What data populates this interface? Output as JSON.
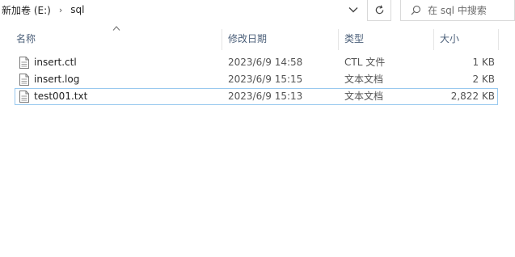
{
  "breadcrumb": {
    "items": [
      "新加卷 (E:)",
      "sql"
    ],
    "separator": "›"
  },
  "search": {
    "placeholder": "在 sql 中搜索"
  },
  "columns": {
    "name": "名称",
    "modified": "修改日期",
    "type": "类型",
    "size": "大小"
  },
  "files": [
    {
      "name": "insert.ctl",
      "modified": "2023/6/9 14:58",
      "type": "CTL 文件",
      "size": "1 KB"
    },
    {
      "name": "insert.log",
      "modified": "2023/6/9 15:15",
      "type": "文本文档",
      "size": "2 KB"
    },
    {
      "name": "test001.txt",
      "modified": "2023/6/9 15:13",
      "type": "文本文档",
      "size": "2,822 KB"
    }
  ],
  "colors": {
    "header_text": "#4c607a",
    "selection_border": "#99c9ef"
  },
  "icons": {
    "dropdown": "chevron-down-icon",
    "refresh": "refresh-icon",
    "search": "search-icon",
    "file": "document-icon",
    "sort": "sort-ascending-icon"
  }
}
